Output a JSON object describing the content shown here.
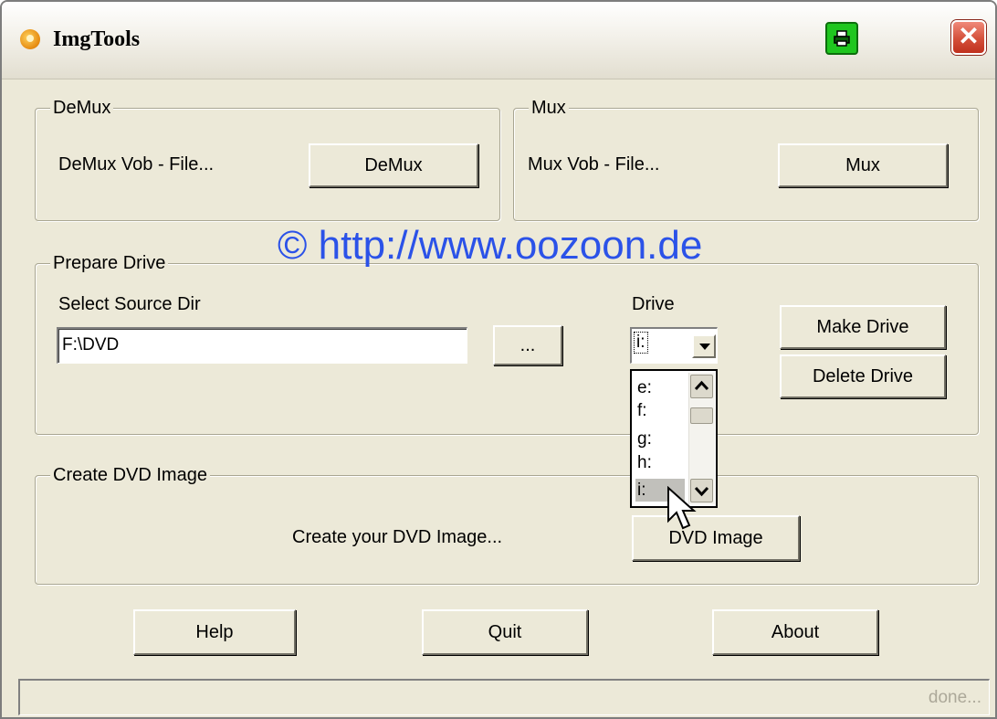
{
  "window": {
    "title": "ImgTools"
  },
  "demux": {
    "legend": "DeMux",
    "label": "DeMux Vob - File...",
    "button": "DeMux"
  },
  "mux": {
    "legend": "Mux",
    "label": "Mux Vob - File...",
    "button": "Mux"
  },
  "watermark": "© http://www.oozoon.de",
  "prepare": {
    "legend": "Prepare Drive",
    "source_label": "Select Source Dir",
    "source_value": "F:\\DVD",
    "browse_button": "...",
    "drive_label": "Drive",
    "drive_value": "i:",
    "drive_options": [
      "e:",
      "f:",
      "g:",
      "h:",
      "i:"
    ],
    "make_button": "Make Drive",
    "delete_button": "Delete Drive"
  },
  "create": {
    "legend": "Create DVD Image",
    "label": "Create your DVD Image...",
    "button": "DVD Image"
  },
  "footer": {
    "help": "Help",
    "quit": "Quit",
    "about": "About"
  },
  "status": "done...",
  "colors": {
    "watermark": "#2b52e8",
    "print_button": "#1fc61f",
    "close_button": "#d4503a"
  }
}
